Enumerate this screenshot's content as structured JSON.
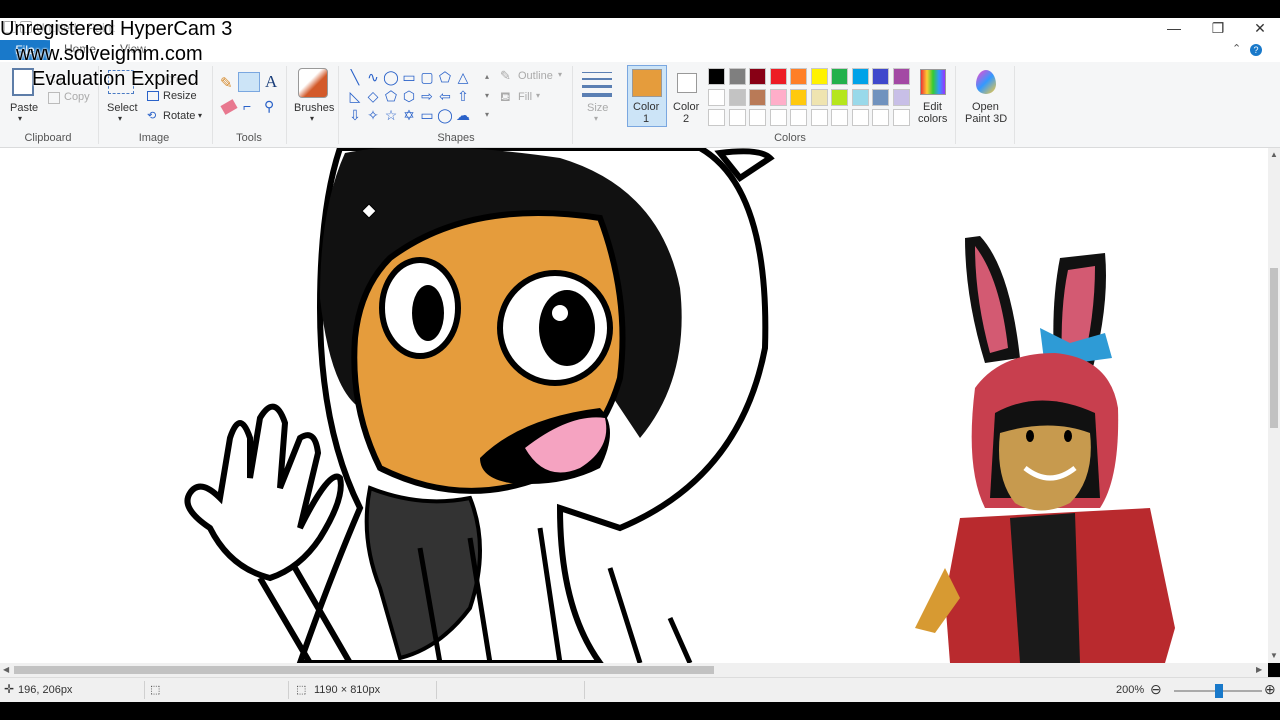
{
  "window": {
    "title": "Untitled - Paint",
    "minimize": "—",
    "maximize": "❐",
    "close": "✕"
  },
  "tabs": {
    "file": "File",
    "home": "Home",
    "view": "View"
  },
  "ribbon": {
    "clipboard": {
      "label": "Clipboard",
      "paste": "Paste",
      "cut": "Cut",
      "copy": "Copy"
    },
    "image": {
      "label": "Image",
      "select": "Select",
      "crop": "Crop",
      "resize": "Resize",
      "rotate": "Rotate"
    },
    "tools": {
      "label": "Tools"
    },
    "brushes": {
      "label": "Brushes"
    },
    "shapes": {
      "label": "Shapes",
      "outline": "Outline",
      "fill": "Fill"
    },
    "size": {
      "label": "Size"
    },
    "colors": {
      "label": "Colors",
      "color1_label": "Color",
      "color1_num": "1",
      "color2_label": "Color",
      "color2_num": "2",
      "edit_colors": "Edit colors",
      "edit_colors_1": "Edit",
      "edit_colors_2": "colors",
      "open_paint3d_1": "Open",
      "open_paint3d_2": "Paint 3D",
      "color1_value": "#e59c3c",
      "color2_value": "#ffffff",
      "palette_row1": [
        "#000000",
        "#7f7f7f",
        "#880015",
        "#ed1c24",
        "#ff7f27",
        "#fff200",
        "#22b14c",
        "#00a2e8",
        "#3f48cc",
        "#a349a4"
      ],
      "palette_row2": [
        "#ffffff",
        "#c3c3c3",
        "#b97a57",
        "#ffaec9",
        "#ffc90e",
        "#efe4b0",
        "#b5e61d",
        "#99d9ea",
        "#7092be",
        "#c8bfe7"
      ],
      "palette_row3": [
        "#ffffff",
        "#ffffff",
        "#ffffff",
        "#ffffff",
        "#ffffff",
        "#ffffff",
        "#ffffff",
        "#ffffff",
        "#ffffff",
        "#ffffff"
      ]
    }
  },
  "watermark": {
    "line1": "Unregistered HyperCam 3",
    "line2": "www.solveigmm.com",
    "line3": "Evaluation Expired"
  },
  "status": {
    "cursor_pos": "196, 206px",
    "canvas_size": "1190 × 810px",
    "zoom": "200%"
  }
}
